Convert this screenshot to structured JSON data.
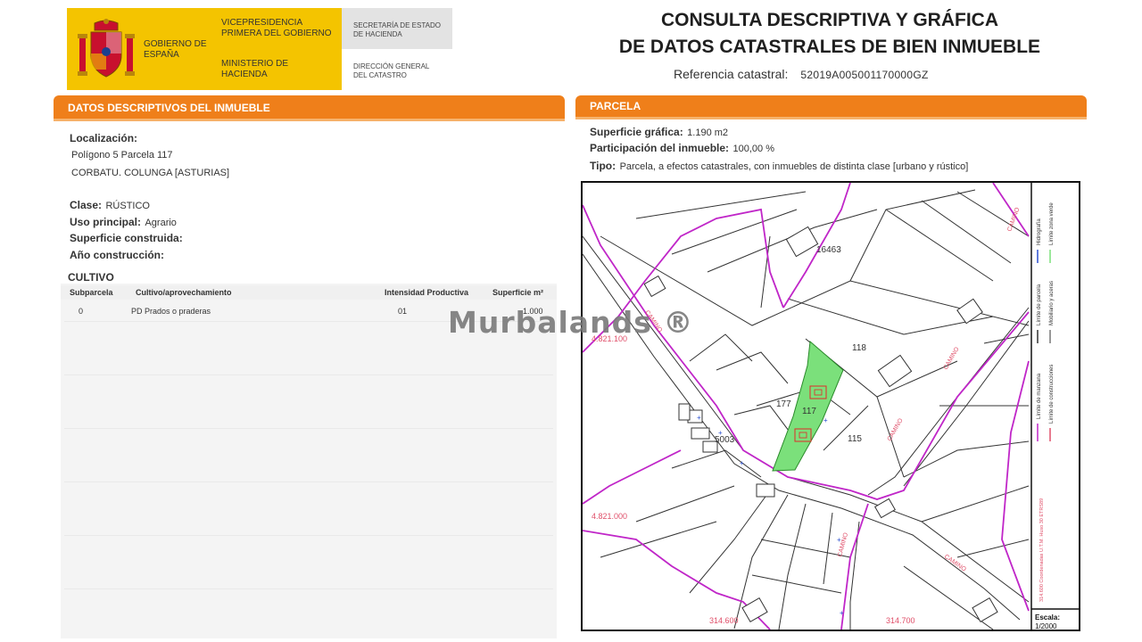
{
  "header": {
    "government": "GOBIERNO DE ESPAÑA",
    "vicepresidency": "VICEPRESIDENCIA PRIMERA DEL GOBIERNO",
    "ministry": "MINISTERIO DE HACIENDA",
    "secretariat": "SECRETARÍA DE ESTADO DE HACIENDA",
    "directorate": "DIRECCIÓN GENERAL DEL CATASTRO",
    "title_line1": "CONSULTA DESCRIPTIVA Y GRÁFICA",
    "title_line2": "DE DATOS CATASTRALES DE BIEN INMUEBLE",
    "ref_label": "Referencia catastral:",
    "ref_value": "52019A005001170000GZ"
  },
  "left": {
    "bar_title": "DATOS DESCRIPTIVOS DEL INMUEBLE",
    "localizacion_label": "Localización:",
    "localizacion_line1": "Polígono 5 Parcela 117",
    "localizacion_line2": "CORBATU. COLUNGA [ASTURIAS]",
    "clase_label": "Clase:",
    "clase_value": "RÚSTICO",
    "uso_label": "Uso principal:",
    "uso_value": "Agrario",
    "superficie_label": "Superficie construida:",
    "ano_label": "Año construcción:",
    "cultivo_title": "CULTIVO",
    "table": {
      "headers": [
        "Subparcela",
        "Cultivo/aprovechamiento",
        "Intensidad Productiva",
        "Superficie m²"
      ],
      "rows": [
        [
          "0",
          "PD Prados o praderas",
          "01",
          "1.000"
        ]
      ]
    }
  },
  "right": {
    "bar_title": "PARCELA",
    "superficie_label": "Superficie gráfica:",
    "superficie_value": "1.190 m2",
    "participacion_label": "Participación del inmueble:",
    "participacion_value": "100,00 %",
    "tipo_label": "Tipo:",
    "tipo_value": "Parcela, a efectos catastrales, con inmuebles de distinta clase [urbano y rústico]"
  },
  "map": {
    "parcel_labels": [
      "16463",
      "118",
      "177",
      "117",
      "115",
      "5003"
    ],
    "coord_y1": "4.821.100",
    "coord_y2": "4.821.000",
    "coord_x1": "314.600",
    "coord_x2": "314.700",
    "scale_label": "Escala:",
    "scale_value": "1/2000",
    "legend": [
      "Límite de manzana",
      "Límite de parcela",
      "Hidrografía",
      "Límite de construcciones",
      "Mobiliario y aceras",
      "Límite zona verde"
    ],
    "projection": "314.600 Coordenadas U.T.M. Huso 30 ETRS89",
    "colors": {
      "boundary": "#c026c8",
      "parcel_fill": "#7be07b",
      "road_text": "#e0506a",
      "lines": "#333333"
    }
  },
  "watermark": "Murbalands ®"
}
